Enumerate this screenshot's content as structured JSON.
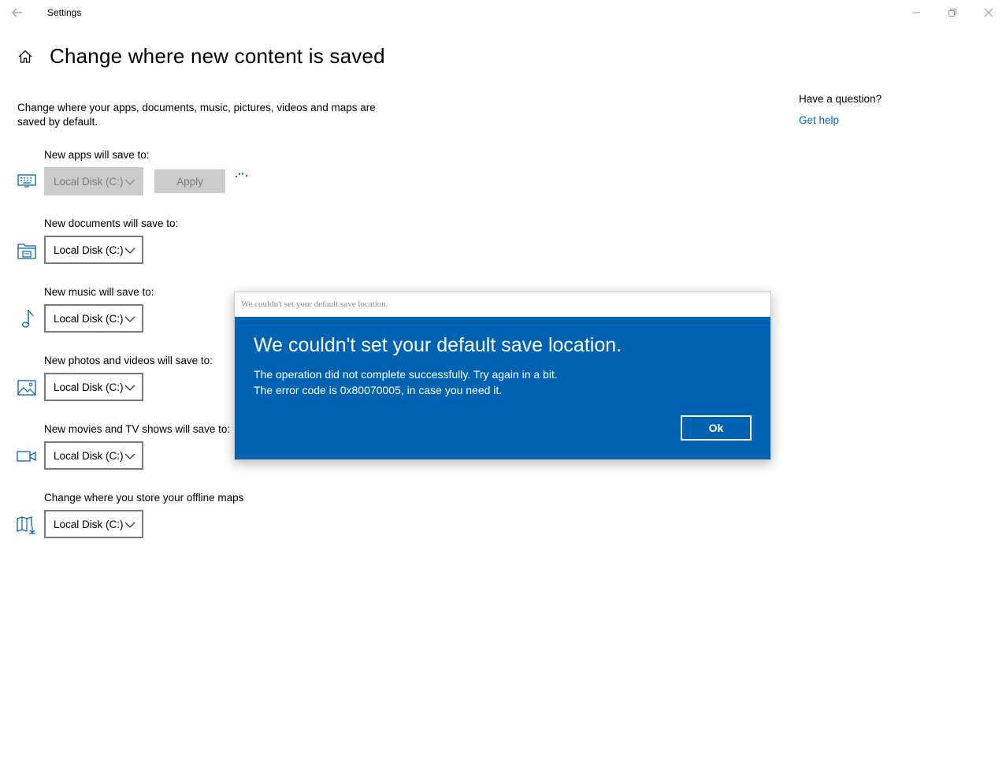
{
  "window": {
    "title": "Settings",
    "back_icon": "back-arrow-icon",
    "minimize_icon": "minimize-icon",
    "maximize_icon": "restore-icon",
    "close_icon": "close-icon"
  },
  "header": {
    "home_icon": "home-icon",
    "title": "Change where new content is saved"
  },
  "description": "Change where your apps, documents, music, pictures, videos and maps are saved by default.",
  "rows": [
    {
      "label": "New apps will save to:",
      "icon": "monitor-keyboard-icon",
      "value": "Local Disk (C:)",
      "disabled": true
    },
    {
      "label": "New documents will save to:",
      "icon": "documents-folder-icon",
      "value": "Local Disk (C:)",
      "disabled": false
    },
    {
      "label": "New music will save to:",
      "icon": "music-note-icon",
      "value": "Local Disk (C:)",
      "disabled": false
    },
    {
      "label": "New photos and videos will save to:",
      "icon": "photo-icon",
      "value": "Local Disk (C:)",
      "disabled": false
    },
    {
      "label": "New movies and TV shows will save to:",
      "icon": "video-camera-icon",
      "value": "Local Disk (C:)",
      "disabled": false
    },
    {
      "label": "Change where you store your offline maps",
      "icon": "map-download-icon",
      "value": "Local Disk (C:)",
      "disabled": false
    }
  ],
  "apply_label": "Apply",
  "help": {
    "title": "Have a question?",
    "link": "Get help"
  },
  "dialog": {
    "window_title": "We couldn't set your default save location.",
    "heading": "We couldn't set your default save location.",
    "message_line1": "The operation did not complete successfully. Try again in a bit.",
    "message_line2": "The error code is 0x80070005, in case you need it.",
    "ok_label": "Ok"
  },
  "colors": {
    "accent": "#0063b1",
    "link": "#0067c0",
    "icon": "#0063b1",
    "disabled_bg": "#cccccc"
  }
}
